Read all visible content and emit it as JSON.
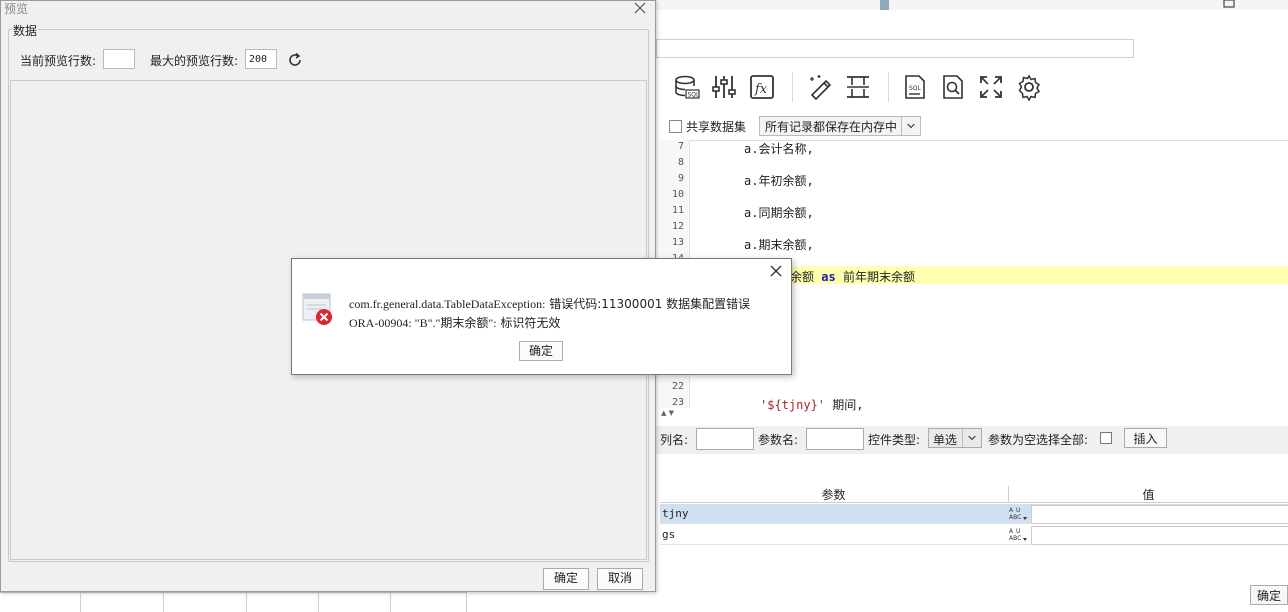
{
  "preview": {
    "title": "预览",
    "group_label": "数据",
    "current_rows_label": "当前预览行数:",
    "current_rows_value": "",
    "max_rows_label": "最大的预览行数:",
    "max_rows_value": "200",
    "ok_label": "确定",
    "cancel_label": "取消"
  },
  "error": {
    "line1_class": "com.fr.general.data.TableDataException:",
    "line1_text": " 错误代码:11300001 数据集配置错误",
    "line2_code": "ORA-00904: \"B\".\"期末余额\":",
    "line2_text": " 标识符无效",
    "ok_label": "确定"
  },
  "editor": {
    "share_dataset_label": "共享数据集",
    "cache_option": "所有记录都保存在内存中",
    "lines": [
      {
        "num": "7",
        "text": "a.会计名称,"
      },
      {
        "num": "8",
        "text": ""
      },
      {
        "num": "9",
        "text": "a.年初余额,"
      },
      {
        "num": "10",
        "text": ""
      },
      {
        "num": "11",
        "text": "a.同期余额,"
      },
      {
        "num": "12",
        "text": ""
      },
      {
        "num": "13",
        "text": "a.期末余额,"
      },
      {
        "num": "14",
        "text": ""
      },
      {
        "num": "22",
        "text": ""
      },
      {
        "num": "23",
        "text": "期间,"
      }
    ],
    "highlight_prefix": "余额",
    "highlight_keyword": "as",
    "highlight_suffix": "前年期末余额",
    "line23_string": "'${tjny}'"
  },
  "params": {
    "column_name_label": "列名:",
    "param_name_label": "参数名:",
    "control_type_label": "控件类型:",
    "control_type_value": "单选",
    "empty_select_all_label": "参数为空选择全部:",
    "insert_label": "插入",
    "table_headers": [
      "参数",
      "值"
    ],
    "rows": [
      {
        "name": "tjny",
        "type_icon": "abc-type-icon"
      },
      {
        "name": "gs",
        "type_icon": "abc-type-icon"
      }
    ],
    "ok_label": "确定"
  },
  "colors": {
    "error_red": "#e0262b",
    "highlight_yellow": "#ffffb0",
    "keyword_blue": "#1d1db8",
    "selected_row": "#cfe0f1"
  }
}
